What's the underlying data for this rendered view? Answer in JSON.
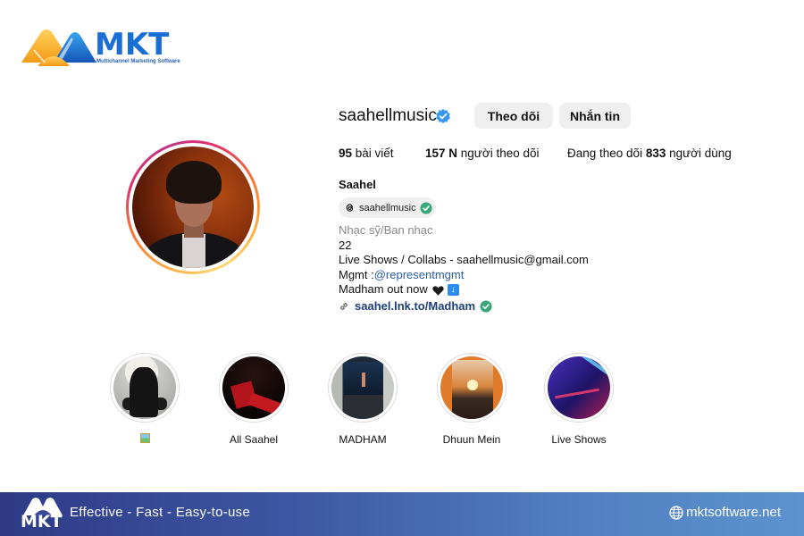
{
  "brand": {
    "name": "MKT",
    "tagline": "Multichannel Marketing Software"
  },
  "profile": {
    "username": "saahellmusic",
    "verified": true,
    "buttons": {
      "follow": "Theo dõi",
      "message": "Nhắn tin"
    },
    "stats": {
      "posts_count": "95",
      "posts_label": " bài viết",
      "followers_count": "157 N",
      "followers_label": " người theo dõi",
      "following_prefix": "Đang theo dõi ",
      "following_count": "833",
      "following_suffix": " người dùng"
    },
    "display_name": "Saahel",
    "threads_handle": "saahellmusic",
    "bio": {
      "category": "Nhạc sỹ/Ban nhạc",
      "line1": "22",
      "line2": "Live Shows / Collabs - saahellmusic@gmail.com",
      "mgmt_prefix": "Mgmt :",
      "mgmt_mention": "@representmgmt",
      "release": "Madham out now",
      "link": "saahel.lnk.to/Madham"
    }
  },
  "highlights": [
    {
      "label": "",
      "icon": "image-icon"
    },
    {
      "label": "All Saahel"
    },
    {
      "label": "MADHAM"
    },
    {
      "label": "Dhuun Mein"
    },
    {
      "label": "Live Shows"
    }
  ],
  "footer": {
    "logo_text": "MKT",
    "slogan": "Effective - Fast - Easy-to-use",
    "website": "mktsoftware.net"
  },
  "colors": {
    "brand_blue": "#1a6fd6",
    "brand_orange": "#f7a928",
    "verified_blue": "#3897f0",
    "check_green": "#3aa779",
    "mention_blue": "#2b5cab"
  }
}
